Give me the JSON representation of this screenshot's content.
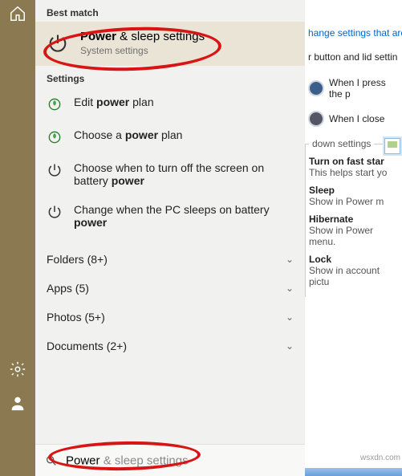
{
  "rail": {
    "home_icon": "home-icon",
    "settings_icon": "gear-icon",
    "user_icon": "user-icon"
  },
  "search": {
    "best_match_header": "Best match",
    "best_match": {
      "title_prefix": "Power",
      "title_suffix": " & sleep settings",
      "subtitle": "System settings"
    },
    "settings_header": "Settings",
    "settings_items": [
      {
        "html": "Edit <b>power</b> plan",
        "icon": "plan"
      },
      {
        "html": "Choose a <b>power</b> plan",
        "icon": "plan"
      },
      {
        "html": "Choose when to turn off the screen on battery <b>power</b>",
        "icon": "power"
      },
      {
        "html": "Change when the PC sleeps on battery <b>power</b>",
        "icon": "power"
      }
    ],
    "categories": [
      {
        "label": "Folders (8+)"
      },
      {
        "label": "Apps (5)"
      },
      {
        "label": "Photos (5+)"
      },
      {
        "label": "Documents (2+)"
      }
    ],
    "input_value": "Power",
    "input_hint": " & sleep settings"
  },
  "behind": {
    "link": "hange settings that are",
    "line2": "r button and lid settin",
    "row_press": "When I press the p",
    "row_close": "When I close",
    "legend": "down settings",
    "items": [
      {
        "h": "Turn on fast star",
        "s": "This helps start yo"
      },
      {
        "h": "Sleep",
        "s": "Show in Power m"
      },
      {
        "h": "Hibernate",
        "s": "Show in Power menu."
      },
      {
        "h": "Lock",
        "s": "Show in account pictu"
      }
    ]
  },
  "watermark": "wsxdn.com"
}
